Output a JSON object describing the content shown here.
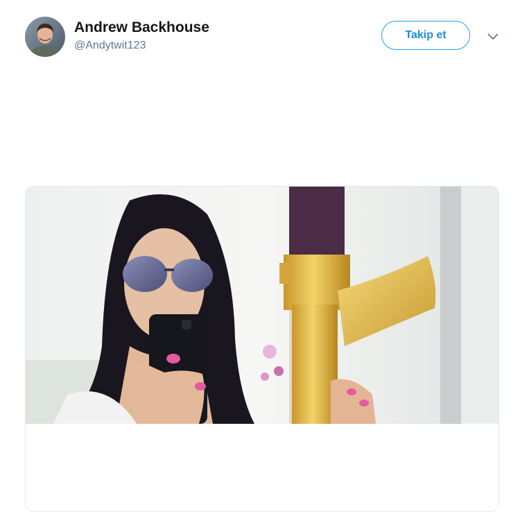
{
  "tweet": {
    "author": {
      "display_name": "Andrew Backhouse",
      "handle": "@Andytwit123",
      "avatar_icon": "person-avatar-icon"
    },
    "follow_button_label": "Takip et",
    "menu_icon": "chevron-down-icon",
    "card": {
      "media_description_icon": "photo-media-icon"
    }
  },
  "colors": {
    "accent": "#1da1f2",
    "text_primary": "#14171a",
    "text_secondary": "#657786",
    "border": "#e1e8ed"
  }
}
